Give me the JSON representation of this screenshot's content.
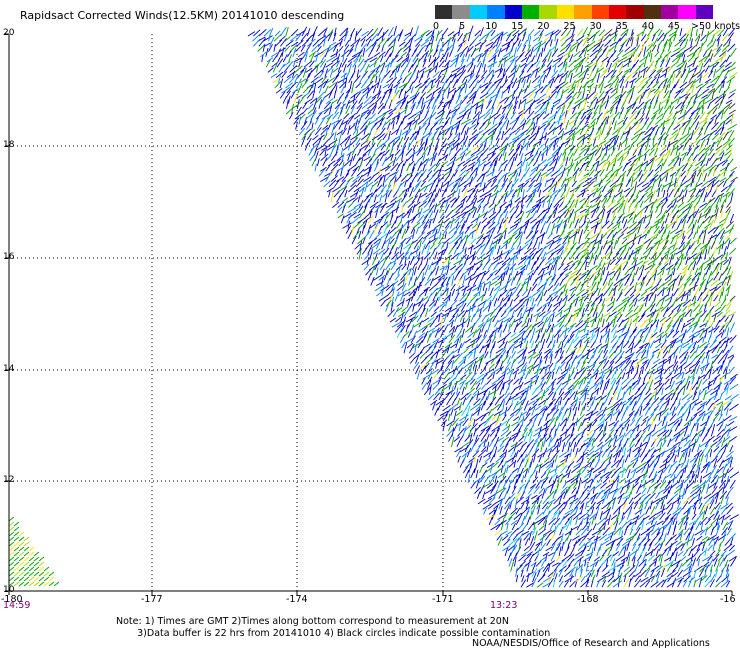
{
  "title": "Rapidsact Corrected Winds(12.5KM) 20141010 descending",
  "legend": {
    "colors": [
      "#303030",
      "#8c8c8c",
      "#00ccff",
      "#0080ff",
      "#0000cc",
      "#00b000",
      "#a8d800",
      "#ffe000",
      "#ffa000",
      "#ff4000",
      "#e00000",
      "#a00000",
      "#503010",
      "#a000a0",
      "#ff00ff",
      "#6000c0"
    ],
    "labels": [
      "0",
      "5",
      "10",
      "15",
      "20",
      "25",
      "30",
      "35",
      "40",
      "45",
      ">50 knots"
    ]
  },
  "axes": {
    "lon_labels": [
      "-180",
      "-177",
      "-174",
      "-171",
      "-168",
      "-16"
    ],
    "lat_labels": [
      "20",
      "18",
      "16",
      "14",
      "12",
      "10"
    ]
  },
  "times": {
    "left": "14:59",
    "mid": "13:23"
  },
  "notes": {
    "line1": "Note: 1) Times are GMT 2)Times along bottom correspond to measurement at 20N",
    "line2": "3)Data buffer is 22 hrs from 20141010 4) Black circles indicate possible contamination"
  },
  "credit": "NOAA/NESDIS/Office of Research and Applications"
}
